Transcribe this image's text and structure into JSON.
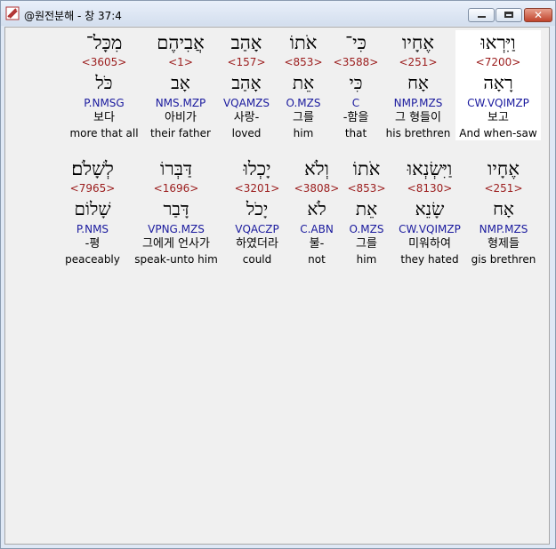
{
  "window": {
    "title": "@원전분해 - 창 37:4",
    "close_glyph": "✕"
  },
  "verse": [
    {
      "hebrew": "מִכָּל־",
      "strong": "<3605>",
      "lexeme": "כֹּל",
      "morph": "P.NMSG",
      "korean": "보다",
      "english": "more that all"
    },
    {
      "hebrew": "אֲבִיהֶם",
      "strong": "<1>",
      "lexeme": "אָב",
      "morph": "NMS.MZP",
      "korean": "아비가",
      "english": "their father"
    },
    {
      "hebrew": "אָהַב",
      "strong": "<157>",
      "lexeme": "אָהַב",
      "morph": "VQAMZS",
      "korean": "사랑-",
      "english": "loved"
    },
    {
      "hebrew": "אֹתוֹ",
      "strong": "<853>",
      "lexeme": "אֵת",
      "morph": "O.MZS",
      "korean": "그를",
      "english": "him"
    },
    {
      "hebrew": "כִּי־",
      "strong": "<3588>",
      "lexeme": "כִּי",
      "morph": "C",
      "korean": "-함을",
      "english": "that"
    },
    {
      "hebrew": "אֶחָיו",
      "strong": "<251>",
      "lexeme": "אָח",
      "morph": "NMP.MZS",
      "korean": "그 형들이",
      "english": "his brethren"
    },
    {
      "hebrew": "וַיִּרְאוּ",
      "strong": "<7200>",
      "lexeme": "רָאָה",
      "morph": "CW.VQIMZP",
      "korean": "보고",
      "english": "And when-saw"
    },
    {
      "hebrew": "לְשָׁלֹם׃",
      "strong": "<7965>",
      "lexeme": "שָׁלוֹם",
      "morph": "P.NMS",
      "korean": "-평",
      "english": "peaceably"
    },
    {
      "hebrew": "דַּבְּרוֹ",
      "strong": "<1696>",
      "lexeme": "דָּבַר",
      "morph": "VPNG.MZS",
      "korean": "그에게 언사가",
      "english": "speak-unto him"
    },
    {
      "hebrew": "יָכְלוּ",
      "strong": "<3201>",
      "lexeme": "יָכֹל",
      "morph": "VQACZP",
      "korean": "하였더라",
      "english": "could"
    },
    {
      "hebrew": "וְלֹא",
      "strong": "<3808>",
      "lexeme": "לֹא",
      "morph": "C.ABN",
      "korean": "불-",
      "english": "not"
    },
    {
      "hebrew": "אֹתוֹ",
      "strong": "<853>",
      "lexeme": "אֵת",
      "morph": "O.MZS",
      "korean": "그를",
      "english": "him"
    },
    {
      "hebrew": "וַיִּשְׂנְאוּ",
      "strong": "<8130>",
      "lexeme": "שָׂנֵא",
      "morph": "CW.VQIMZP",
      "korean": "미워하여",
      "english": "they hated"
    },
    {
      "hebrew": "אֶחָיו",
      "strong": "<251>",
      "lexeme": "אָח",
      "morph": "NMP.MZS",
      "korean": "형제들",
      "english": "gis brethren"
    }
  ],
  "colors": {
    "strong": "#9b1c1c",
    "morph": "#1a1a9e",
    "highlight": "#ffffff"
  }
}
